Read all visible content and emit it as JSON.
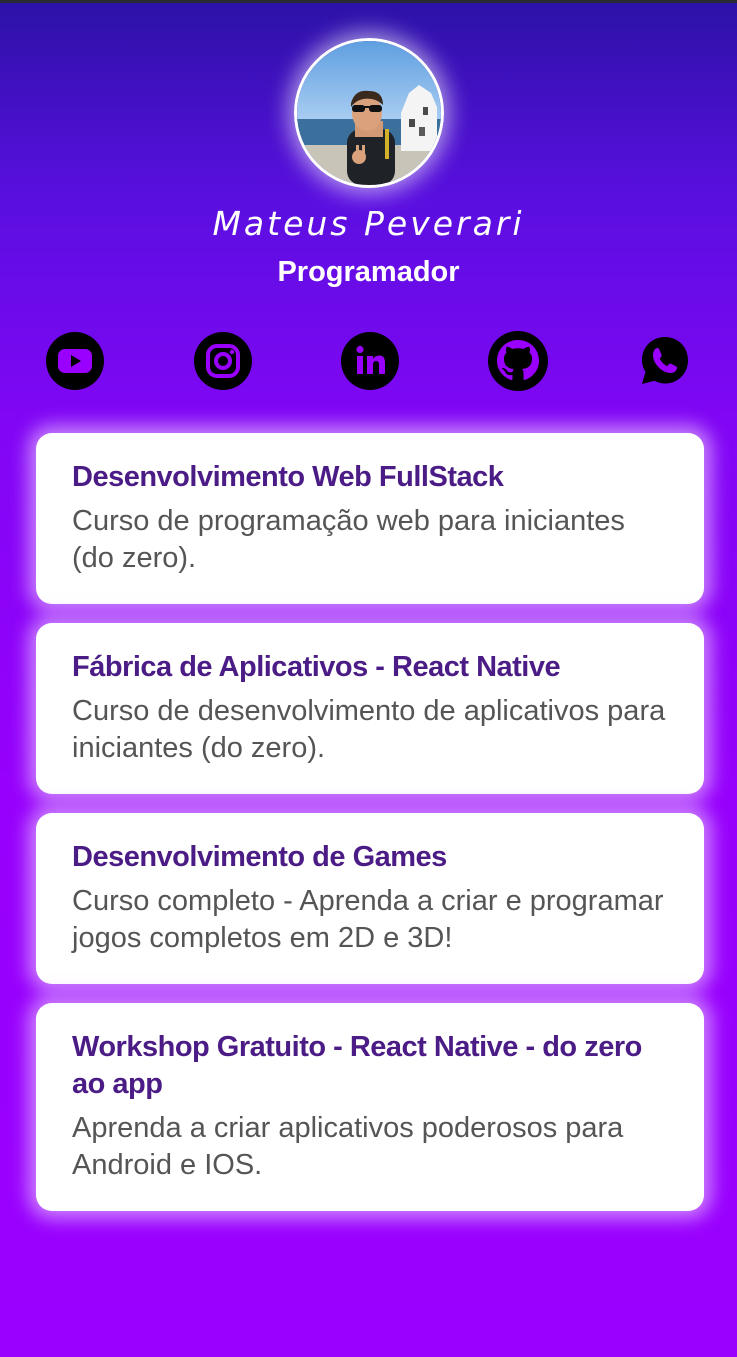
{
  "profile": {
    "name": "Mateus Peverari",
    "role": "Programador"
  },
  "socials": [
    {
      "icon": "youtube-icon"
    },
    {
      "icon": "instagram-icon"
    },
    {
      "icon": "linkedin-icon"
    },
    {
      "icon": "github-icon"
    },
    {
      "icon": "whatsapp-icon"
    }
  ],
  "cards": [
    {
      "title": "Desenvolvimento Web FullStack",
      "description": "Curso de programação web para iniciantes (do zero)."
    },
    {
      "title": "Fábrica de Aplicativos - React Native",
      "description": "Curso de desenvolvimento de aplicativos para iniciantes (do zero)."
    },
    {
      "title": "Desenvolvimento de Games",
      "description": "Curso completo - Aprenda a criar e programar jogos completos em 2D e 3D!"
    },
    {
      "title": "Workshop Gratuito - React Native - do zero ao app",
      "description": "Aprenda a criar aplicativos poderosos para Android e IOS."
    }
  ],
  "colors": {
    "background_top": "#2c12a7",
    "background_bottom": "#9a00ff",
    "card_title": "#4b1b86",
    "card_text": "#555555"
  }
}
